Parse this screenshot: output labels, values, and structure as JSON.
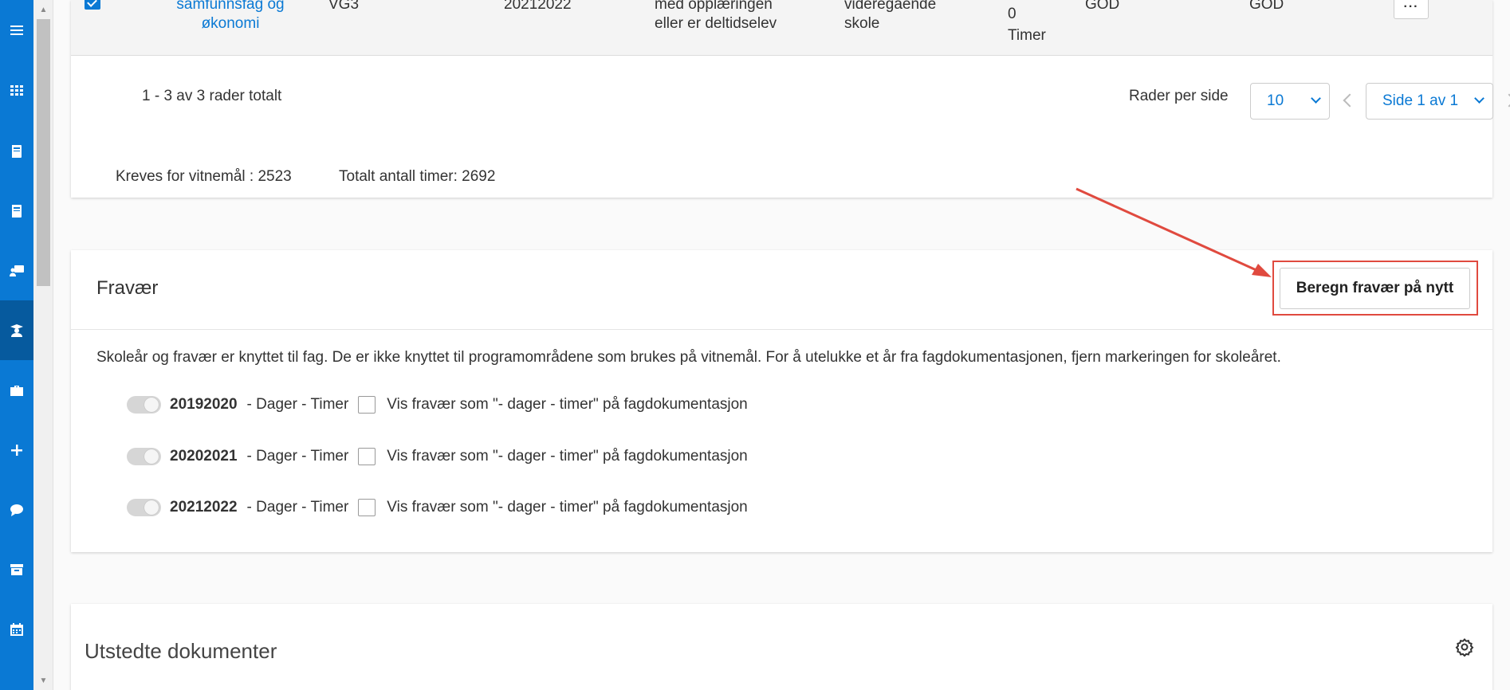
{
  "table": {
    "row": {
      "subject": "samfunnsfag og økonomi",
      "level": "VG3",
      "year": "20212022",
      "reason": "med opplæringen eller er deltidselev",
      "school": "videregående skole",
      "hours_prefix": "0",
      "hours_label": "Timer",
      "grade1": "GOD",
      "grade2": "GOD",
      "more_label": "···"
    },
    "footer": {
      "summary": "1 - 3 av 3 rader totalt",
      "rows_per_page_label": "Rader per side",
      "rows_per_page_value": "10",
      "page_value": "Side 1 av 1"
    },
    "totals": {
      "required": "Kreves for vitnemål : 2523",
      "total_hours": "Totalt antall timer: 2692"
    }
  },
  "fravaer": {
    "title": "Fravær",
    "recalc_button": "Beregn fravær på nytt",
    "info": "Skoleår og fravær er knyttet til fag. De er ikke knyttet til programområdene som brukes på vitnemål. For å utelukke et år fra fagdokumentasjonen, fjern markeringen for skoleåret.",
    "years": [
      {
        "year": "20192020",
        "days_hours": "- Dager - Timer",
        "checkbox_label": "Vis fravær som \"- dager - timer\" på fagdokumentasjon"
      },
      {
        "year": "20202021",
        "days_hours": "- Dager - Timer",
        "checkbox_label": "Vis fravær som \"- dager - timer\" på fagdokumentasjon"
      },
      {
        "year": "20212022",
        "days_hours": "- Dager - Timer",
        "checkbox_label": "Vis fravær som \"- dager - timer\" på fagdokumentasjon"
      }
    ]
  },
  "utstedte": {
    "title": "Utstedte dokumenter"
  },
  "nav": {
    "icons": [
      "menu-icon",
      "apps-grid-icon",
      "book-icon",
      "book-icon",
      "teacher-board-icon",
      "student-icon",
      "briefcase-icon",
      "plus-icon",
      "chat-icon",
      "archive-icon",
      "calendar-icon"
    ],
    "accent": "#0a79d4",
    "active_bg": "#065a9e"
  },
  "annotation_color": "#e04a3f"
}
